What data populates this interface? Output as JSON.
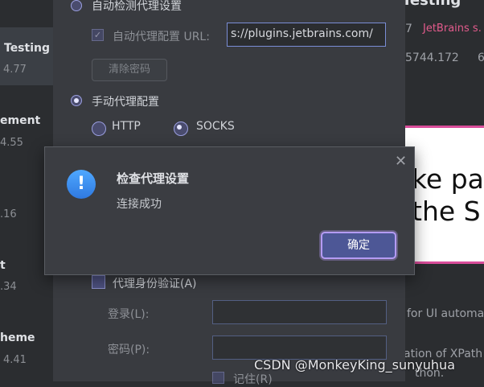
{
  "left_list": {
    "items": [
      {
        "title": "Testing",
        "number": "4.77"
      },
      {
        "title": "ement",
        "number": "4.55"
      },
      {
        "title": "",
        "number": ".16"
      },
      {
        "title": "t",
        "number": ".34"
      },
      {
        "title": "heme",
        "number": "4.41"
      }
    ]
  },
  "plugin_detail": {
    "title_fragment": "Testing",
    "version_fragment": "7",
    "vendor_link": "JetBrains s.",
    "downloads_fragment": "5744.172",
    "rating_fragment": "6",
    "image_line1": "ke par",
    "image_line2": " the S",
    "desc_line1": "for UI automa",
    "desc_line2": "ation of XPath",
    "desc_line3": "thon."
  },
  "proxy": {
    "auto_detect_label": "自动检测代理设置",
    "auto_config_label": "自动代理配置 URL:",
    "auto_config_url": "s://plugins.jetbrains.com/",
    "clear_password_label": "清除密码",
    "manual_label": "手动代理配置",
    "http_label": "HTTP",
    "socks_label": "SOCKS",
    "auth_label": "代理身份验证(A)",
    "login_label": "登录(L):",
    "password_label": "密码(P):",
    "remember_label": "记住(R)"
  },
  "alert": {
    "title": "检查代理设置",
    "message": "连接成功",
    "ok_label": "确定",
    "icon": "info-exclamation-icon",
    "close_icon": "close-icon"
  },
  "watermark": "CSDN @MonkeyKing_sunyuhua",
  "colors": {
    "accent": "#b49bf3",
    "ok_button": "#4d5796",
    "vendor_link": "#e35b8c",
    "info_icon": "#3b8df0"
  }
}
